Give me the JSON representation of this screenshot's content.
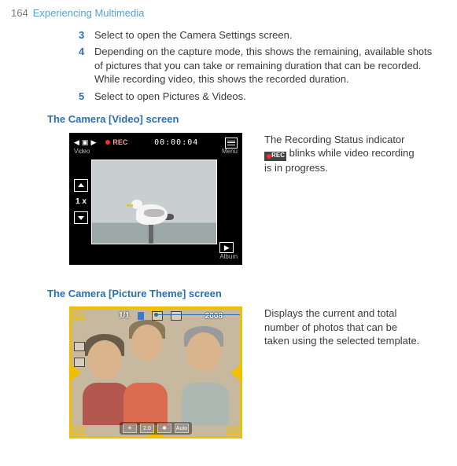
{
  "header": {
    "page_number": "164",
    "chapter": "Experiencing Multimedia"
  },
  "steps": [
    {
      "n": "3",
      "t": "Select to open the Camera Settings screen."
    },
    {
      "n": "4",
      "t": "Depending on the capture mode, this shows the remaining, available shots of pictures that you can take or remaining duration that can be recorded. While recording video, this shows the recorded duration."
    },
    {
      "n": "5",
      "t": "Select to open Pictures & Videos."
    }
  ],
  "video": {
    "heading": "The Camera [Video] screen",
    "top_label": "Video",
    "rec_label": "REC",
    "time": "00:00:04",
    "menu_label": "Menu",
    "zoom": "1 x",
    "album_label": "Album",
    "annotation_a": "The Recording Status indicator ",
    "annotation_b": " blinks while video recording is in progress.",
    "inline_rec": "REC"
  },
  "theme": {
    "heading": "The Camera [Picture Theme] screen",
    "count": "1/1",
    "year": "2008",
    "bottom_ev": "2.0",
    "bottom_auto": "Auto",
    "annotation": "Displays the current and total number of photos that can be taken using the selected template."
  }
}
